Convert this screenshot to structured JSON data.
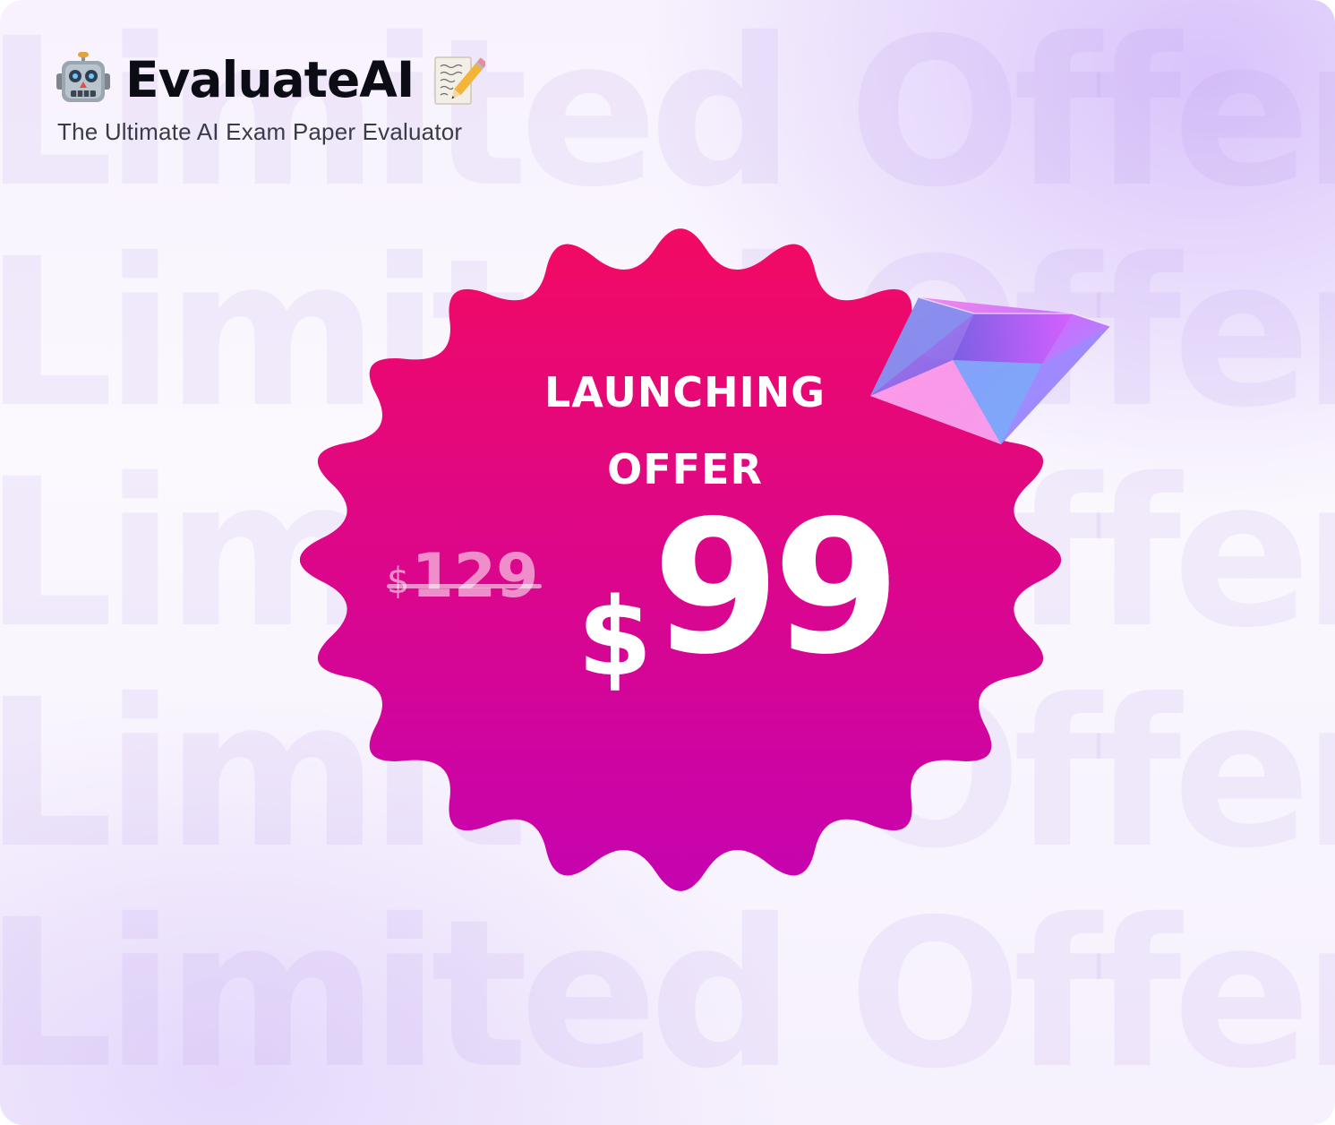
{
  "brand": {
    "title": "EvaluateAI",
    "subtitle": "The Ultimate AI Exam Paper Evaluator",
    "left_icon": "robot-emoji-icon",
    "right_icon": "memo-emoji-icon"
  },
  "background": {
    "repeated_text": "Limited Offer"
  },
  "offer": {
    "headline_line1": "LAUNCHING",
    "headline_line2": "OFFER",
    "old_price_currency": "$",
    "old_price_amount": "129",
    "new_price_currency": "$",
    "new_price_amount": "99"
  },
  "decor": {
    "gem_icon": "diamond-gem-icon"
  },
  "colors": {
    "badge_top": "#f20a63",
    "badge_bottom": "#c603b0",
    "title_text": "#0c0c14",
    "subtitle_text": "#3b3b48"
  }
}
